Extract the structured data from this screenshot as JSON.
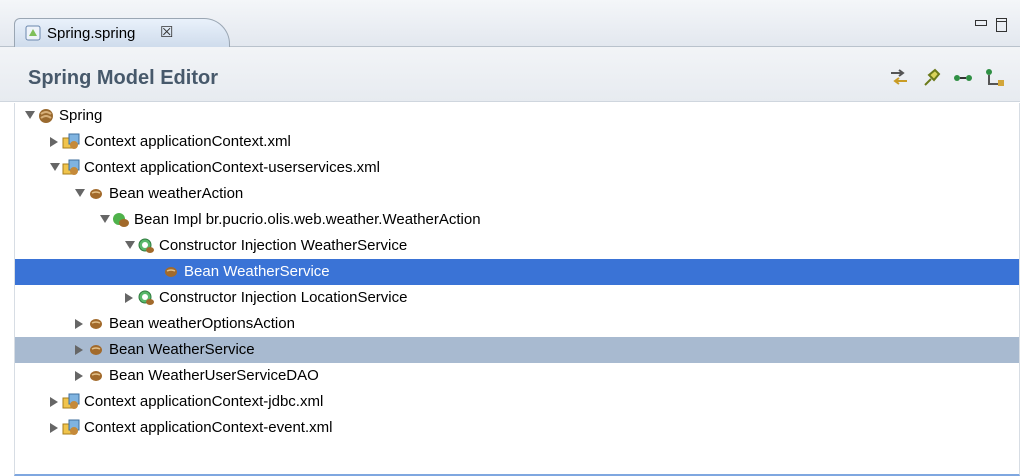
{
  "tab": {
    "label": "Spring.spring",
    "close": "☒"
  },
  "editor": {
    "title": "Spring Model Editor"
  },
  "toolbar": [
    {
      "name": "sync-icon"
    },
    {
      "name": "pin-icon"
    },
    {
      "name": "link-icon"
    },
    {
      "name": "hierarchy-icon"
    }
  ],
  "tree": [
    {
      "depth": 0,
      "expanded": true,
      "icon": "spring",
      "label": "Spring"
    },
    {
      "depth": 1,
      "expanded": false,
      "icon": "context",
      "label": "Context applicationContext.xml"
    },
    {
      "depth": 1,
      "expanded": true,
      "icon": "context",
      "label": "Context applicationContext-userservices.xml"
    },
    {
      "depth": 2,
      "expanded": true,
      "icon": "bean",
      "label": "Bean weatherAction"
    },
    {
      "depth": 3,
      "expanded": true,
      "icon": "beanimpl",
      "label": "Bean Impl br.pucrio.olis.web.weather.WeatherAction"
    },
    {
      "depth": 4,
      "expanded": true,
      "icon": "ctor",
      "label": "Constructor Injection WeatherService"
    },
    {
      "depth": 5,
      "expanded": null,
      "icon": "bean",
      "label": "Bean WeatherService",
      "state": "selected"
    },
    {
      "depth": 4,
      "expanded": false,
      "icon": "ctor",
      "label": "Constructor Injection LocationService"
    },
    {
      "depth": 2,
      "expanded": false,
      "icon": "bean",
      "label": "Bean weatherOptionsAction"
    },
    {
      "depth": 2,
      "expanded": false,
      "icon": "bean",
      "label": "Bean WeatherService",
      "state": "highlight"
    },
    {
      "depth": 2,
      "expanded": false,
      "icon": "bean",
      "label": "Bean WeatherUserServiceDAO"
    },
    {
      "depth": 1,
      "expanded": false,
      "icon": "context",
      "label": "Context applicationContext-jdbc.xml"
    },
    {
      "depth": 1,
      "expanded": false,
      "icon": "context",
      "label": "Context applicationContext-event.xml"
    }
  ]
}
